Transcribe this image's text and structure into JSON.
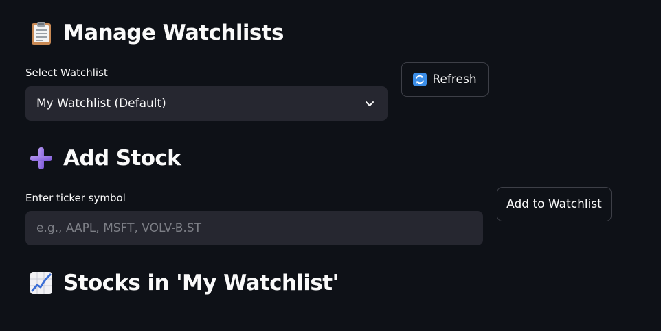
{
  "manage": {
    "title": "Manage Watchlists",
    "icon": "clipboard-icon",
    "select_label": "Select Watchlist",
    "selected_value": "My Watchlist (Default)",
    "refresh_label": "Refresh",
    "refresh_icon": "refresh-icon"
  },
  "add": {
    "title": "Add Stock",
    "icon": "plus-icon",
    "input_label": "Enter ticker symbol",
    "input_placeholder": "e.g., AAPL, MSFT, VOLV-B.ST",
    "button_label": "Add to Watchlist"
  },
  "stocks": {
    "title": "Stocks in 'My Watchlist'",
    "icon": "chart-increasing-icon"
  },
  "colors": {
    "background": "#0e1117",
    "input_bg": "#262730",
    "text": "#fafafa",
    "placeholder": "#7d7f86",
    "button_border": "#3d3f47"
  }
}
